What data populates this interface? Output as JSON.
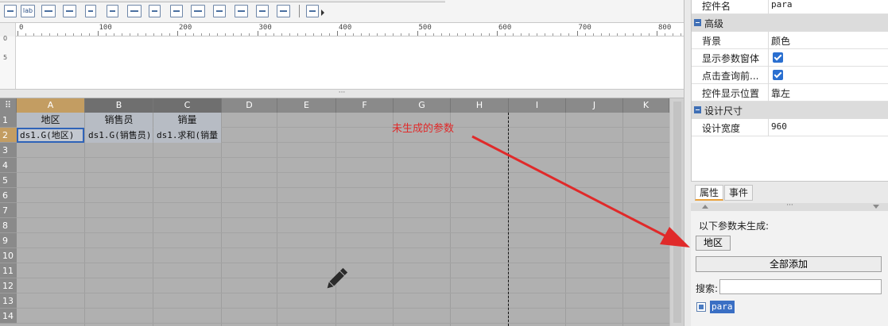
{
  "toolbar": {
    "label_button": "lab",
    "icons": [
      "textbox-icon",
      "label-icon",
      "rect-button-icon",
      "dropdown-icon",
      "list-icon",
      "date-icon",
      "number-icon",
      "tree-icon",
      "radio-group-icon",
      "textarea-icon",
      "more-icon",
      "checkbox-group-icon",
      "tree-combo-icon",
      "edit-widget-icon"
    ]
  },
  "ruler": {
    "labels": [
      "0",
      "100",
      "200",
      "300",
      "400",
      "500",
      "600",
      "700",
      "800"
    ]
  },
  "vruler": {
    "labels": [
      "0",
      "5"
    ]
  },
  "grid": {
    "columns": [
      "A",
      "B",
      "C",
      "D",
      "E",
      "F",
      "G",
      "H",
      "I",
      "J",
      "K"
    ],
    "rows": [
      "1",
      "2",
      "3",
      "4",
      "5",
      "6",
      "7",
      "8",
      "9",
      "10",
      "11",
      "12",
      "13",
      "14"
    ],
    "header_row": [
      "地区",
      "销售员",
      "销量"
    ],
    "data_row": [
      "ds1.G(地区)",
      "ds1.G(销售员)",
      "ds1.求和(销量"
    ]
  },
  "annotation": "未生成的参数",
  "annotation_color": "#e02a2a",
  "properties": {
    "control_name_key": "控件名",
    "control_name_value": "para",
    "advanced_section": "高级",
    "background_key": "背景",
    "background_value": "颜色",
    "show_param_window_key": "显示参数窗体",
    "show_param_window_checked": true,
    "click_query_key": "点击查询前...",
    "click_query_checked": true,
    "control_position_key": "控件显示位置",
    "control_position_value": "靠左",
    "design_size_section": "设计尺寸",
    "design_width_key": "设计宽度",
    "design_width_value": "960"
  },
  "panel_tabs": {
    "attributes": "属性",
    "events": "事件"
  },
  "ungenerated": {
    "title": "以下参数未生成:",
    "param_button": "地区",
    "add_all_button": "全部添加",
    "search_label": "搜索:",
    "search_value": "",
    "tree_item": "para"
  }
}
